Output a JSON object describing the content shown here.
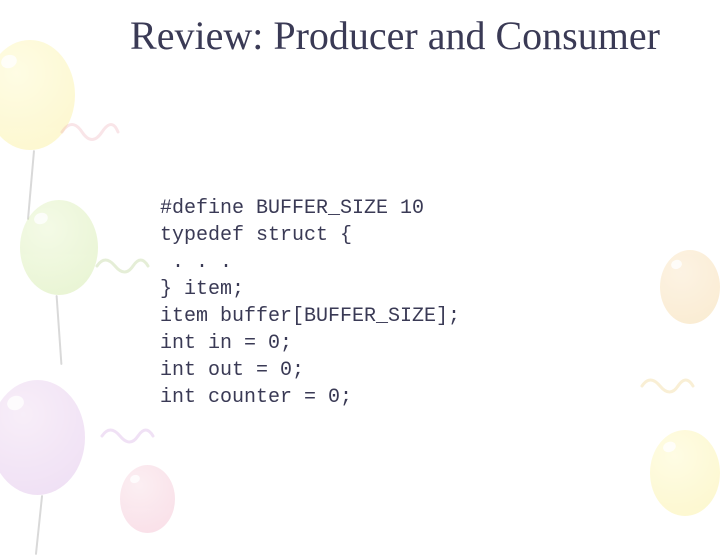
{
  "title": "Review: Producer and Consumer",
  "code": [
    "#define BUFFER_SIZE 10",
    "typedef struct {",
    " . . .",
    "} item;",
    "item buffer[BUFFER_SIZE];",
    "int in = 0;",
    "int out = 0;",
    "int counter = 0;"
  ]
}
